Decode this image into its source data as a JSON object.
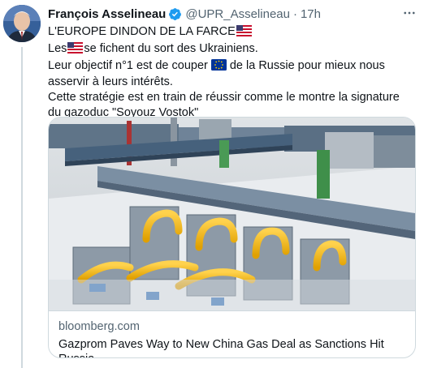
{
  "tweet": {
    "author_name": "François Asselineau",
    "handle": "@UPR_Asselineau",
    "separator": "·",
    "time": "17h",
    "line1": "L'EUROPE DINDON DE LA FARCE",
    "line2_before": "Les",
    "line2_after": "se fichent du sort des Ukrainiens.",
    "line3_before": "Leur objectif n°1 est de couper",
    "line3_after": "de la Russie pour mieux nous asservir à leurs intérêts.",
    "line4": "Cette stratégie est en train de réussir comme le montre la signature du gazoduc \"Soyouz Vostok\""
  },
  "card": {
    "domain": "bloomberg.com",
    "title": "Gazprom Paves Way to New China Gas Deal as Sanctions Hit Russia"
  },
  "icons": {
    "verified": "verified-badge-icon",
    "more": "more-options-icon",
    "flag_us": "us-flag-icon",
    "flag_eu": "eu-flag-icon"
  },
  "colors": {
    "verified_blue": "#1d9bf0",
    "text": "#0f1419",
    "secondary": "#536471",
    "border": "#cfd9de"
  }
}
